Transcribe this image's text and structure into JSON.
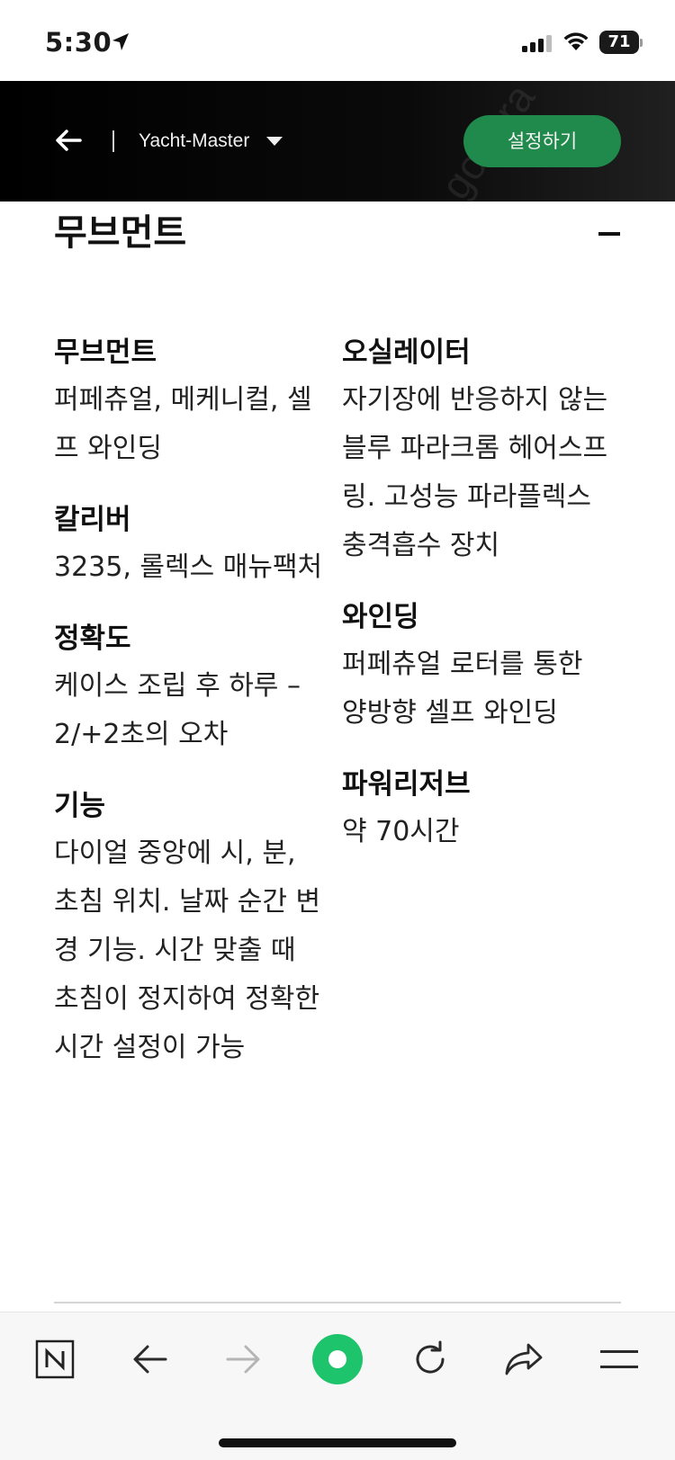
{
  "status_bar": {
    "time": "5:30",
    "battery": "71",
    "icons": [
      "location-arrow-icon",
      "cellular-signal-icon",
      "wifi-icon",
      "battery-icon"
    ]
  },
  "header": {
    "back_icon": "arrow-left-icon",
    "model_label": "Yacht-Master",
    "dropdown_icon": "caret-down-icon",
    "setup_button": "설정하기",
    "accent_color": "#1f8a4b"
  },
  "section": {
    "title": "무브먼트",
    "collapse_icon": "minus-icon",
    "left_specs": [
      {
        "label": "무브먼트",
        "value": "퍼페츄얼, 메케니컬, 셀프 와인딩"
      },
      {
        "label": "칼리버",
        "value": "3235, 롤렉스 매뉴팩처"
      },
      {
        "label": "정확도",
        "value": "케이스 조립 후 하루 –2/+2초의 오차"
      },
      {
        "label": "기능",
        "value": "다이얼 중앙에 시, 분, 초침 위치. 날짜 순간 변경 기능. 시간 맞출 때 초침이 정지하여 정확한 시간 설정이 가능"
      }
    ],
    "right_specs": [
      {
        "label": "오실레이터",
        "value": "자기장에 반응하지 않는 블루 파라크롬 헤어스프링. 고성능 파라플렉스 충격흡수 장치"
      },
      {
        "label": "와인딩",
        "value": "퍼페츄얼 로터를 통한 양방향 셀프 와인딩"
      },
      {
        "label": "파워리저브",
        "value": "약 70시간"
      }
    ]
  },
  "toolbar": {
    "items": [
      "naver-n-icon",
      "back-arrow-icon",
      "forward-arrow-icon",
      "green-circle-icon",
      "reload-icon",
      "share-icon",
      "menu-icon"
    ],
    "green_color": "#1ec46b"
  }
}
